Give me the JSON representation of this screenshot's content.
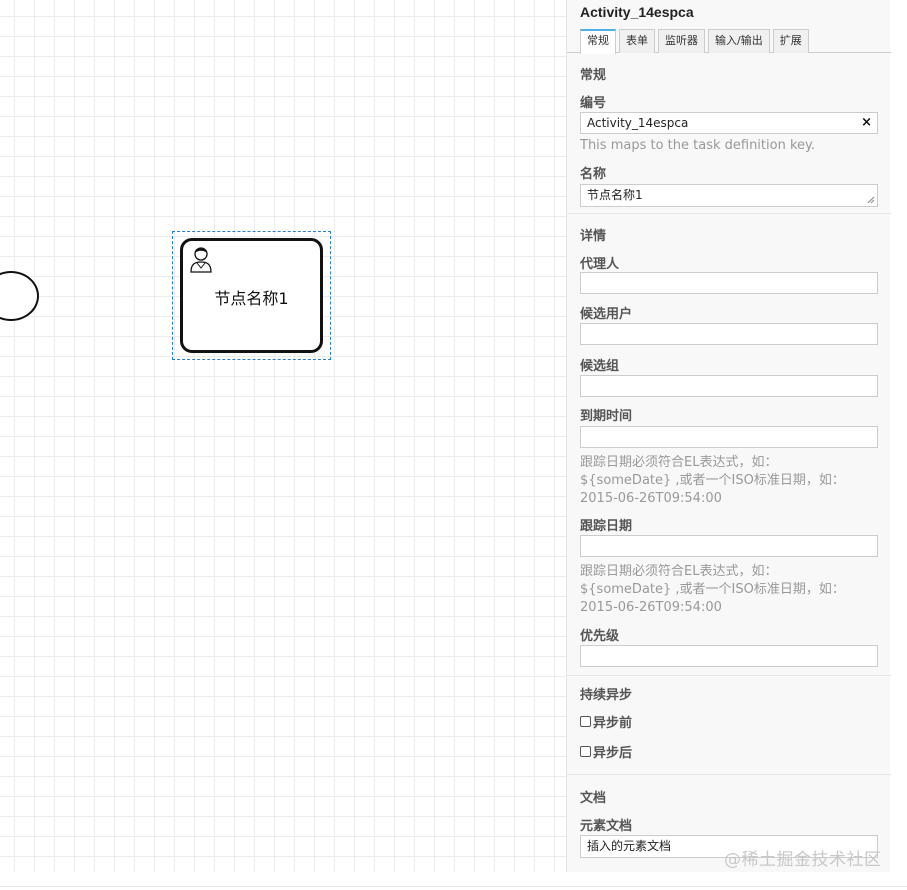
{
  "diagram": {
    "task_label": "节点名称1"
  },
  "panel": {
    "title": "Activity_14espca",
    "tabs": [
      "常规",
      "表单",
      "监听器",
      "输入/输出",
      "扩展"
    ],
    "general": {
      "section": "常规",
      "id_label": "编号",
      "id_value": "Activity_14espca",
      "clear_icon": "×",
      "id_hint": "This maps to the task definition key.",
      "name_label": "名称",
      "name_value": "节点名称1"
    },
    "details": {
      "section": "详情",
      "assignee_label": "代理人",
      "assignee_value": "",
      "candidate_users_label": "候选用户",
      "candidate_users_value": "",
      "candidate_groups_label": "候选组",
      "candidate_groups_value": "",
      "due_date_label": "到期时间",
      "due_date_value": "",
      "due_date_hint": [
        "跟踪日期必须符合EL表达式，如：",
        "${someDate} ,或者一个ISO标准日期，如：",
        "2015-06-26T09:54:00"
      ],
      "follow_up_label": "跟踪日期",
      "follow_up_value": "",
      "follow_up_hint": [
        "跟踪日期必须符合EL表达式，如：",
        "${someDate} ,或者一个ISO标准日期，如：",
        "2015-06-26T09:54:00"
      ],
      "priority_label": "优先级",
      "priority_value": ""
    },
    "async": {
      "section": "持续异步",
      "before_label": "异步前",
      "after_label": "异步后"
    },
    "documentation": {
      "section": "文档",
      "element_doc_label": "元素文档",
      "element_doc_value": "插入的元素文档"
    }
  },
  "watermark": "@稀土掘金技术社区"
}
